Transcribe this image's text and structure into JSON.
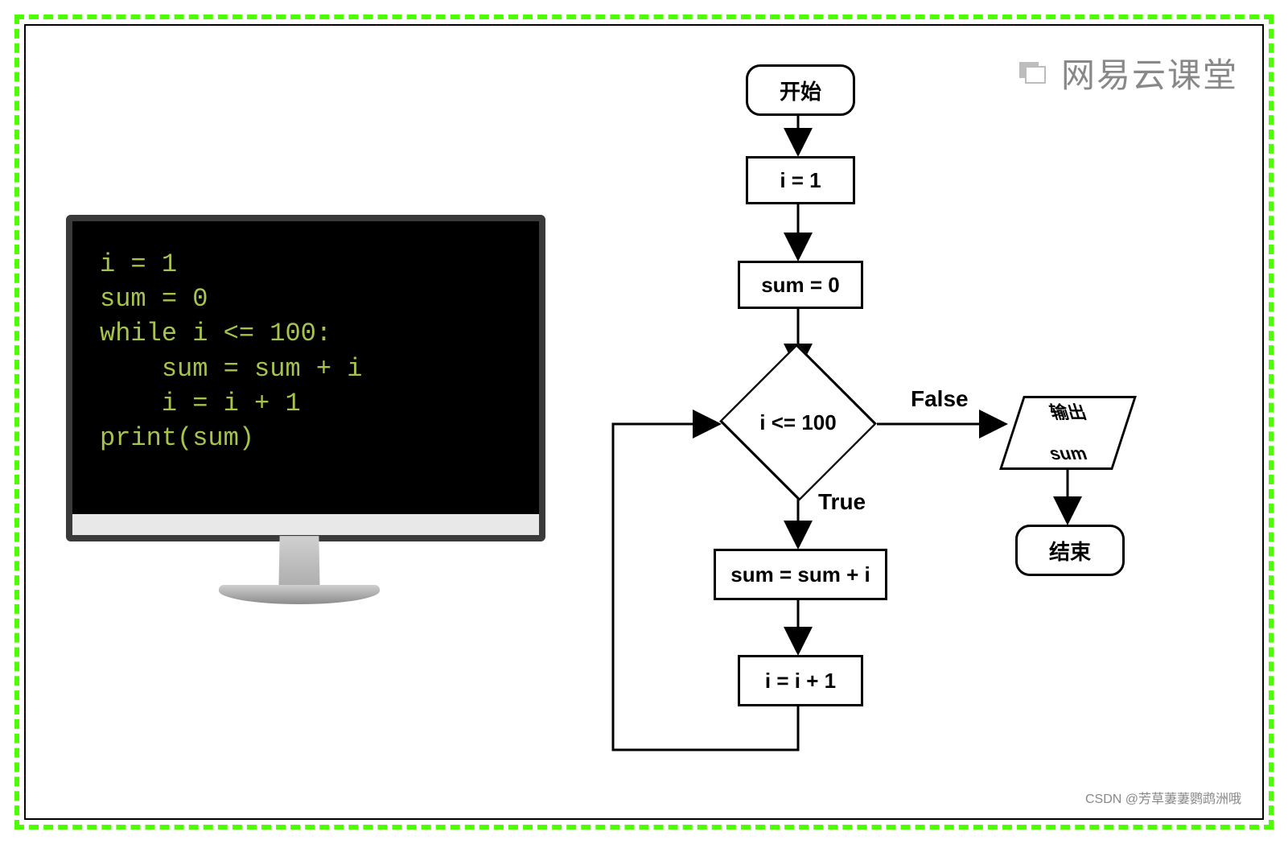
{
  "watermark": "网易云课堂",
  "credit_prefix": "CSDN ",
  "credit_user": "@芳草萋萋鹦鹉洲哦",
  "code": {
    "l1": "i = 1",
    "l2": "sum = 0",
    "l3": "while i <= 100:",
    "l4": "    sum = sum + i",
    "l5": "    i = i + 1",
    "l6": "print(sum)"
  },
  "flow": {
    "start": "开始",
    "init_i": "i = 1",
    "init_sum": "sum = 0",
    "cond": "i <= 100",
    "true": "True",
    "false": "False",
    "body1": "sum = sum + i",
    "body2": "i = i + 1",
    "output1": "输出",
    "output2": "sum",
    "end": "结束"
  }
}
